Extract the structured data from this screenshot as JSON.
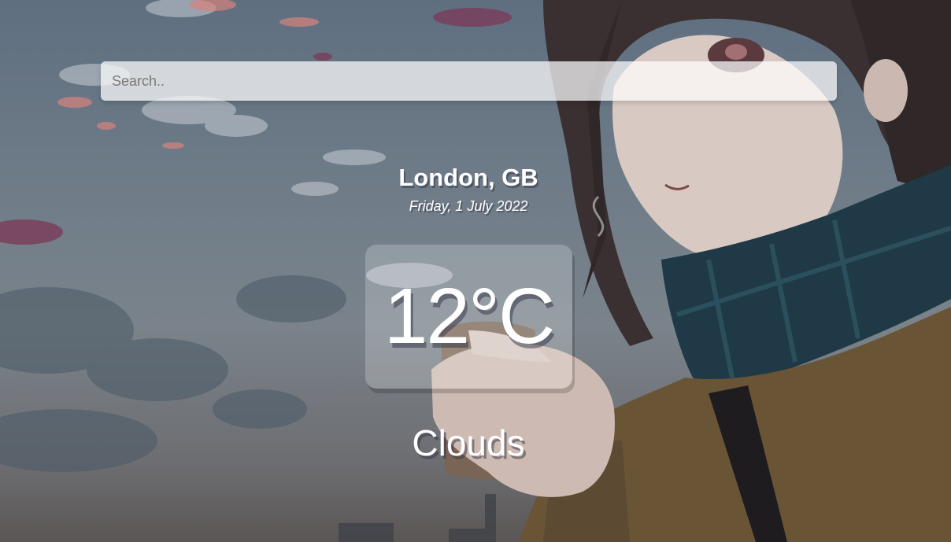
{
  "search": {
    "placeholder": "Search.."
  },
  "location": {
    "city_country": "London, GB",
    "date": "Friday, 1 July 2022"
  },
  "weather": {
    "temperature": "12°C",
    "condition": "Clouds"
  },
  "background": {
    "description_icon": "anime-girl-background-image"
  }
}
